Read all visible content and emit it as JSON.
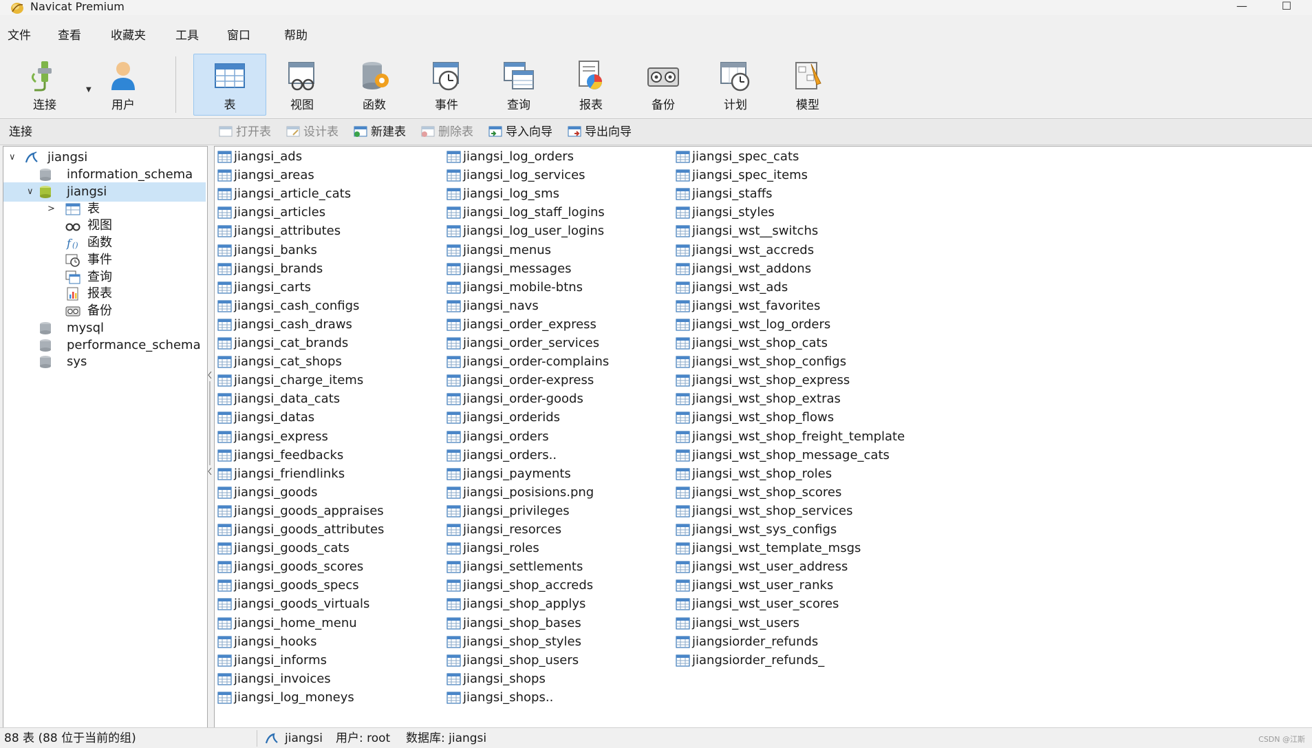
{
  "app": {
    "title": "Navicat Premium",
    "window_controls": {
      "minimize": "—",
      "maximize": "☐"
    }
  },
  "menu": {
    "items": [
      "文件",
      "查看",
      "收藏夹",
      "工具",
      "窗口",
      "帮助"
    ]
  },
  "toolbar": {
    "buttons": [
      {
        "label": "连接",
        "icon": "connection-icon"
      },
      {
        "label": "用户",
        "icon": "user-icon"
      },
      {
        "label": "表",
        "icon": "table-icon",
        "active": true
      },
      {
        "label": "视图",
        "icon": "view-icon"
      },
      {
        "label": "函数",
        "icon": "function-icon"
      },
      {
        "label": "事件",
        "icon": "event-icon"
      },
      {
        "label": "查询",
        "icon": "query-icon"
      },
      {
        "label": "报表",
        "icon": "report-icon"
      },
      {
        "label": "备份",
        "icon": "backup-icon"
      },
      {
        "label": "计划",
        "icon": "schedule-icon"
      },
      {
        "label": "模型",
        "icon": "model-icon"
      }
    ]
  },
  "subbar": {
    "connection_label": "连接",
    "actions": [
      {
        "label": "打开表",
        "enabled": false
      },
      {
        "label": "设计表",
        "enabled": false
      },
      {
        "label": "新建表",
        "enabled": true
      },
      {
        "label": "删除表",
        "enabled": false
      },
      {
        "label": "导入向导",
        "enabled": true
      },
      {
        "label": "导出向导",
        "enabled": true
      }
    ]
  },
  "tree": {
    "connection": "jiangsi",
    "databases": [
      {
        "name": "information_schema"
      },
      {
        "name": "jiangsi",
        "selected": true,
        "expanded": true,
        "children": [
          "表",
          "视图",
          "函数",
          "事件",
          "查询",
          "报表",
          "备份"
        ]
      },
      {
        "name": "mysql"
      },
      {
        "name": "performance_schema"
      },
      {
        "name": "sys"
      }
    ]
  },
  "tables": {
    "column_1": [
      "jiangsi_ads",
      "jiangsi_areas",
      "jiangsi_article_cats",
      "jiangsi_articles",
      "jiangsi_attributes",
      "jiangsi_banks",
      "jiangsi_brands",
      "jiangsi_carts",
      "jiangsi_cash_configs",
      "jiangsi_cash_draws",
      "jiangsi_cat_brands",
      "jiangsi_cat_shops",
      "jiangsi_charge_items",
      "jiangsi_data_cats",
      "jiangsi_datas",
      "jiangsi_express",
      "jiangsi_feedbacks",
      "jiangsi_friendlinks",
      "jiangsi_goods",
      "jiangsi_goods_appraises",
      "jiangsi_goods_attributes",
      "jiangsi_goods_cats",
      "jiangsi_goods_scores",
      "jiangsi_goods_specs",
      "jiangsi_goods_virtuals",
      "jiangsi_home_menu",
      "jiangsi_hooks",
      "jiangsi_informs",
      "jiangsi_invoices",
      "jiangsi_log_moneys"
    ],
    "column_2": [
      "jiangsi_log_orders",
      "jiangsi_log_services",
      "jiangsi_log_sms",
      "jiangsi_log_staff_logins",
      "jiangsi_log_user_logins",
      "jiangsi_menus",
      "jiangsi_messages",
      "jiangsi_mobile-btns",
      "jiangsi_navs",
      "jiangsi_order_express",
      "jiangsi_order_services",
      "jiangsi_order-complains",
      "jiangsi_order-express",
      "jiangsi_order-goods",
      "jiangsi_orderids",
      "jiangsi_orders",
      "jiangsi_orders..",
      "jiangsi_payments",
      "jiangsi_posisions.png",
      "jiangsi_privileges",
      "jiangsi_resorces",
      "jiangsi_roles",
      "jiangsi_settlements",
      "jiangsi_shop_accreds",
      "jiangsi_shop_applys",
      "jiangsi_shop_bases",
      "jiangsi_shop_styles",
      "jiangsi_shop_users",
      "jiangsi_shops",
      "jiangsi_shops.."
    ],
    "column_3": [
      "jiangsi_spec_cats",
      "jiangsi_spec_items",
      "jiangsi_staffs",
      "jiangsi_styles",
      "jiangsi_wst__switchs",
      "jiangsi_wst_accreds",
      "jiangsi_wst_addons",
      "jiangsi_wst_ads",
      "jiangsi_wst_favorites",
      "jiangsi_wst_log_orders",
      "jiangsi_wst_shop_cats",
      "jiangsi_wst_shop_configs",
      "jiangsi_wst_shop_express",
      "jiangsi_wst_shop_extras",
      "jiangsi_wst_shop_flows",
      "jiangsi_wst_shop_freight_template",
      "jiangsi_wst_shop_message_cats",
      "jiangsi_wst_shop_roles",
      "jiangsi_wst_shop_scores",
      "jiangsi_wst_shop_services",
      "jiangsi_wst_sys_configs",
      "jiangsi_wst_template_msgs",
      "jiangsi_wst_user_address",
      "jiangsi_wst_user_ranks",
      "jiangsi_wst_user_scores",
      "jiangsi_wst_users",
      "jiangsiorder_refunds",
      "jiangsiorder_refunds_"
    ]
  },
  "status": {
    "count_text": "88 表 (88 位于当前的组)",
    "connection": "jiangsi",
    "user": "用户: root",
    "database": "数据库: jiangsi",
    "watermark": "CSDN @江斯"
  },
  "colors": {
    "selection": "#cce4f7",
    "active_tool": "#cfe4f8",
    "table_icon": "#4a86c8"
  }
}
